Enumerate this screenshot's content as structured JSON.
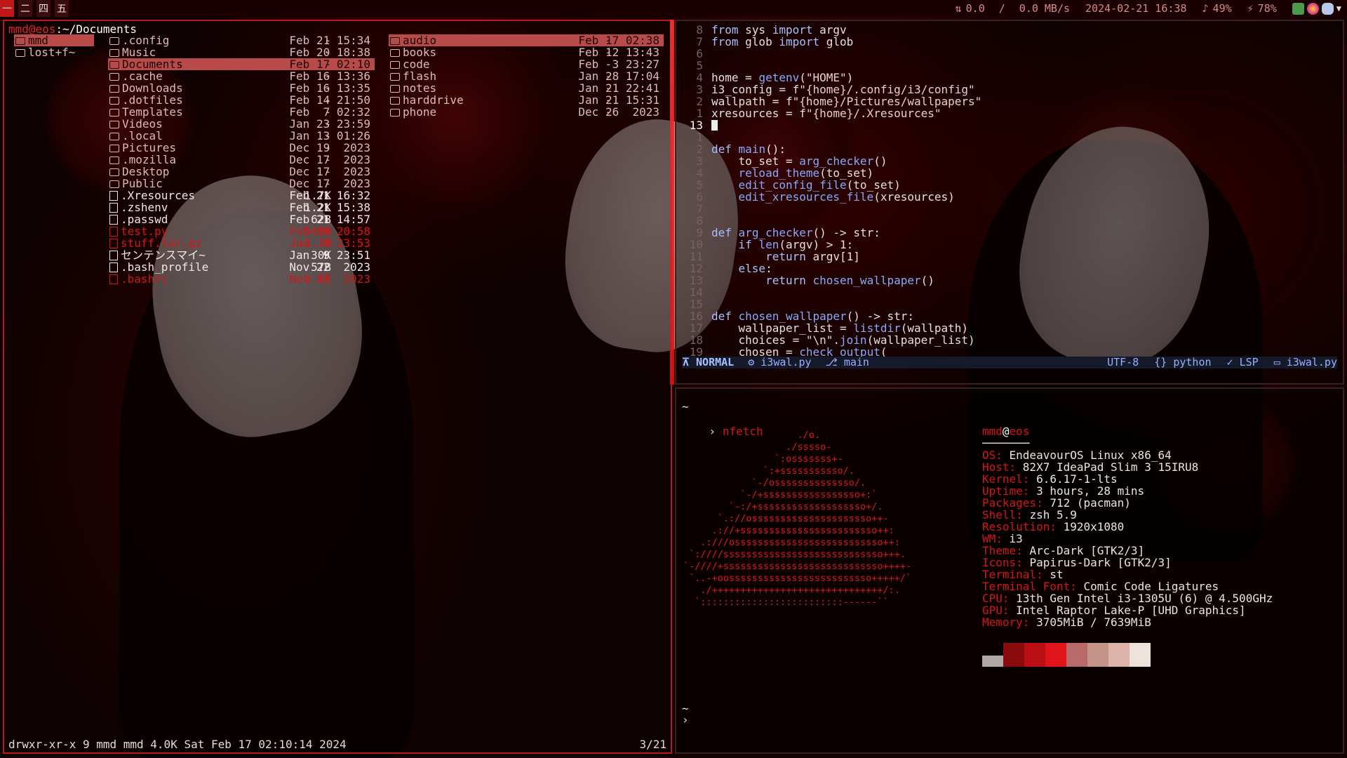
{
  "bar": {
    "workspaces": [
      "一",
      "二",
      "四",
      "五"
    ],
    "active_workspace": 0,
    "net_up": "0.0",
    "net_sep": "/",
    "net_down": "0.0 MB/s",
    "datetime": "2024-02-21 16:38",
    "volume": "49%",
    "battery": "78%"
  },
  "file_manager": {
    "user_host": "mmd@eos",
    "path": "~/Documents",
    "parent": [
      {
        "name": "mmd",
        "selected": true
      },
      {
        "name": "lost+f~",
        "selected": false
      }
    ],
    "current": [
      {
        "name": ".config",
        "size": "-",
        "date": "Feb 21 15:34",
        "kind": "dir"
      },
      {
        "name": "Music",
        "size": "-",
        "date": "Feb 20 18:38",
        "kind": "dir"
      },
      {
        "name": "Documents",
        "size": "-",
        "date": "Feb 17 02:10",
        "kind": "dir",
        "selected": true
      },
      {
        "name": ".cache",
        "size": "-",
        "date": "Feb 16 13:36",
        "kind": "dir"
      },
      {
        "name": "Downloads",
        "size": "-",
        "date": "Feb 16 13:35",
        "kind": "dir"
      },
      {
        "name": ".dotfiles",
        "size": "-",
        "date": "Feb 14 21:50",
        "kind": "dir"
      },
      {
        "name": "Templates",
        "size": "-",
        "date": "Feb  7 02:32",
        "kind": "dir"
      },
      {
        "name": "Videos",
        "size": "-",
        "date": "Jan 23 23:59",
        "kind": "dir"
      },
      {
        "name": ".local",
        "size": "-",
        "date": "Jan 13 01:26",
        "kind": "dir"
      },
      {
        "name": "Pictures",
        "size": "-",
        "date": "Dec 19  2023",
        "kind": "dir"
      },
      {
        "name": ".mozilla",
        "size": "-",
        "date": "Dec 17  2023",
        "kind": "dir"
      },
      {
        "name": "Desktop",
        "size": "-",
        "date": "Dec 17  2023",
        "kind": "dir"
      },
      {
        "name": "Public",
        "size": "-",
        "date": "Dec 17  2023",
        "kind": "dir"
      },
      {
        "name": ".Xresources",
        "size": "1.7K",
        "date": "Feb 21 16:32",
        "kind": "file"
      },
      {
        "name": ".zshenv",
        "size": "1.2K",
        "date": "Feb 21 15:38",
        "kind": "file"
      },
      {
        "name": ".passwd",
        "size": "62B",
        "date": "Feb 21 14:57",
        "kind": "file"
      },
      {
        "name": "test.py",
        "size": "549B",
        "date": "Feb 19 20:58",
        "kind": "red"
      },
      {
        "name": "stuff.tar.gz",
        "size": "3.1M",
        "date": "Jan  9 23:53",
        "kind": "red"
      },
      {
        "name": "センテンスマイ~",
        "size": "30K",
        "date": "Jan  9 23:51",
        "kind": "file"
      },
      {
        "name": ".bash_profile",
        "size": "57B",
        "date": "Nov 22  2023",
        "kind": "file"
      },
      {
        "name": ".bashrc",
        "size": "2.6K",
        "date": "Nov 17  2023",
        "kind": "red"
      }
    ],
    "preview": [
      {
        "name": "audio",
        "size": "-",
        "date": "Feb 17 02:38",
        "selected": true
      },
      {
        "name": "books",
        "size": "-",
        "date": "Feb 12 13:43"
      },
      {
        "name": "code",
        "size": "-",
        "date": "Feb  3 23:27"
      },
      {
        "name": "flash",
        "size": "-",
        "date": "Jan 28 17:04"
      },
      {
        "name": "notes",
        "size": "-",
        "date": "Jan 21 22:41"
      },
      {
        "name": "harddrive",
        "size": "-",
        "date": "Jan 21 15:31"
      },
      {
        "name": "phone",
        "size": "-",
        "date": "Dec 26  2023"
      }
    ],
    "footer": "drwxr-xr-x 9 mmd mmd 4.0K Sat Feb 17 02:10:14 2024",
    "position": "3/21"
  },
  "editor": {
    "lines": [
      {
        "n": "8",
        "text": "from sys import argv"
      },
      {
        "n": "7",
        "text": "from glob import glob"
      },
      {
        "n": "6",
        "text": ""
      },
      {
        "n": "5",
        "text": ""
      },
      {
        "n": "4",
        "text": "home = getenv(\"HOME\")"
      },
      {
        "n": "3",
        "text": "i3_config = f\"{home}/.config/i3/config\""
      },
      {
        "n": "2",
        "text": "wallpath = f\"{home}/Pictures/wallpapers\""
      },
      {
        "n": "1",
        "text": "xresources = f\"{home}/.Xresources\""
      },
      {
        "n": "13",
        "text": "",
        "current": true
      },
      {
        "n": "1",
        "text": ""
      },
      {
        "n": "2",
        "text": "def main():"
      },
      {
        "n": "3",
        "text": "    to_set = arg_checker()"
      },
      {
        "n": "4",
        "text": "    reload_theme(to_set)"
      },
      {
        "n": "5",
        "text": "    edit_config_file(to_set)"
      },
      {
        "n": "6",
        "text": "    edit_xresources_file(xresources)"
      },
      {
        "n": "7",
        "text": ""
      },
      {
        "n": "8",
        "text": ""
      },
      {
        "n": "9",
        "text": "def arg_checker() -> str:"
      },
      {
        "n": "10",
        "text": "    if len(argv) > 1:"
      },
      {
        "n": "11",
        "text": "        return argv[1]"
      },
      {
        "n": "12",
        "text": "    else:"
      },
      {
        "n": "13",
        "text": "        return chosen_wallpaper()"
      },
      {
        "n": "14",
        "text": ""
      },
      {
        "n": "15",
        "text": ""
      },
      {
        "n": "16",
        "text": "def chosen_wallpaper() -> str:"
      },
      {
        "n": "17",
        "text": "    wallpaper_list = listdir(wallpath)"
      },
      {
        "n": "18",
        "text": "    choices = \"\\n\".join(wallpaper_list)"
      },
      {
        "n": "19",
        "text": "    chosen = check_output("
      }
    ],
    "status": {
      "mode": "NORMAL",
      "file": "i3wal.py",
      "branch": "main",
      "encoding": "UTF-8",
      "filetype": "python",
      "lsp": "LSP",
      "project": "i3wal.py"
    }
  },
  "terminal": {
    "tilde": "~",
    "prompt": "›",
    "command": "nfetch",
    "ascii_art": [
      "                    ./o.",
      "                  ./sssso-",
      "                `:osssssss+-",
      "              `:+sssssssssso/.",
      "            `-/ossssssssssssso/.",
      "          `-/+sssssssssssssssso+:`",
      "        `-:/+sssssssssssssssssso+/.",
      "      `.://osssssssssssssssssssso++-",
      "     .://+ssssssssssssssssssssssso++:",
      "   .:///ossssssssssssssssssssssssso++:",
      " `:////ssssssssssssssssssssssssssso+++.",
      "`-////+ssssssssssssssssssssssssssso++++-",
      " `..-+oosssssssssssssssssssssssso+++++/`",
      "   ./++++++++++++++++++++++++++++++/:.",
      "  `:::::::::::::::::::::::::------``"
    ],
    "user": "mmd",
    "host": "eos",
    "info": [
      {
        "k": "OS",
        "v": "EndeavourOS Linux x86_64"
      },
      {
        "k": "Host",
        "v": "82X7 IdeaPad Slim 3 15IRU8"
      },
      {
        "k": "Kernel",
        "v": "6.6.17-1-lts"
      },
      {
        "k": "Uptime",
        "v": "3 hours, 28 mins"
      },
      {
        "k": "Packages",
        "v": "712 (pacman)"
      },
      {
        "k": "Shell",
        "v": "zsh 5.9"
      },
      {
        "k": "Resolution",
        "v": "1920x1080"
      },
      {
        "k": "WM",
        "v": "i3"
      },
      {
        "k": "Theme",
        "v": "Arc-Dark [GTK2/3]"
      },
      {
        "k": "Icons",
        "v": "Papirus-Dark [GTK2/3]"
      },
      {
        "k": "Terminal",
        "v": "st"
      },
      {
        "k": "Terminal Font",
        "v": "Comic Code Ligatures"
      },
      {
        "k": "CPU",
        "v": "13th Gen Intel i3-1305U (6) @ 4.500GHz"
      },
      {
        "k": "GPU",
        "v": "Intel Raptor Lake-P [UHD Graphics]"
      },
      {
        "k": "Memory",
        "v": "3705MiB / 7639MiB"
      }
    ],
    "palette": [
      "#b0a8a8",
      "#8a0a0e",
      "#b80e14",
      "#e0141a",
      "#b86a6a",
      "#c49488",
      "#dcb4aa",
      "#eee2dc"
    ],
    "tilde2": "~",
    "prompt2": "›"
  }
}
